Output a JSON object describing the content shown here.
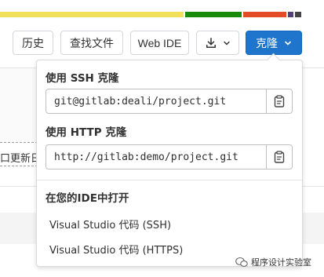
{
  "colors": {
    "accent": "#1f75cb",
    "language_bar": [
      "#f1e05a",
      "#1a8a0a",
      "#e34c26",
      "#563d7c",
      "#444444"
    ]
  },
  "toolbar": {
    "history_label": "历史",
    "find_file_label": "查找文件",
    "web_ide_label": "Web IDE",
    "download_icon": "download-icon",
    "clone_label": "克隆"
  },
  "background": {
    "partial_text": "口更新日"
  },
  "clone_dropdown": {
    "ssh": {
      "title": "使用 SSH 克隆",
      "url": "git@gitlab:deali/project.git",
      "copy_icon": "clipboard-icon"
    },
    "http": {
      "title": "使用 HTTP 克隆",
      "url": "http://gitlab:demo/project.git",
      "copy_icon": "clipboard-icon"
    },
    "ide_section_title": "在您的IDE中打开",
    "ide_items": [
      {
        "label": "Visual Studio 代码 (SSH)"
      },
      {
        "label": "Visual Studio 代码 (HTTPS)"
      }
    ]
  },
  "watermark": {
    "text": "程序设计实验室"
  }
}
